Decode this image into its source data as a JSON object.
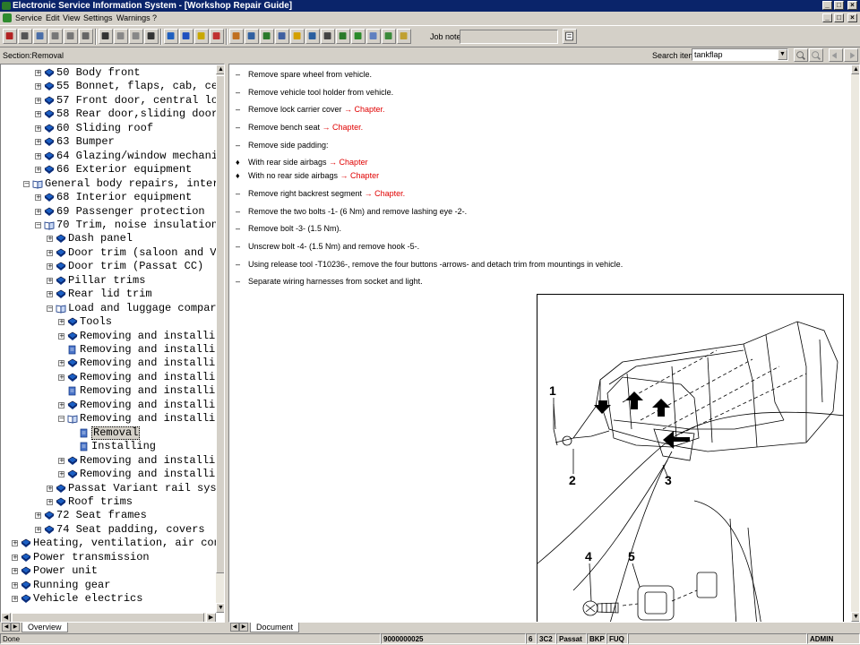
{
  "window": {
    "title": "Electronic Service Information System - [Workshop Repair Guide]",
    "controls": [
      "_",
      "□",
      "×"
    ],
    "mdi_controls": [
      "_",
      "□",
      "×"
    ]
  },
  "menu": [
    "Service",
    "Edit",
    "View",
    "Settings",
    "Warnings",
    "?"
  ],
  "toolbar": {
    "buttons": [
      "exit-icon",
      "print-icon",
      "print-preview-icon",
      "new-document-icon",
      "copy-icon",
      "vehicle-icon",
      "first-page-icon",
      "previous-page-icon",
      "next-page-icon",
      "last-page-icon",
      "back-icon",
      "info-icon",
      "help-icon",
      "swap-icon",
      "grid-icon",
      "person-icon",
      "documents-icon",
      "list-icon",
      "warning-icon",
      "globe-icon",
      "save-icon",
      "book-icon",
      "car-icon",
      "notes-icon",
      "check-icon",
      "edit-icon"
    ],
    "job_note_label": "Job note:",
    "job_note_value": ""
  },
  "section": {
    "label": "Section:Removal",
    "search_label": "Search item:",
    "search_value": "tankflap"
  },
  "tree": {
    "nodes": [
      {
        "label": "50 Body front",
        "level": 3,
        "expander": "+",
        "icon": "book-closed",
        "selected": false
      },
      {
        "label": "55 Bonnet, flaps, cab, ce",
        "level": 3,
        "expander": "+",
        "icon": "book-closed",
        "selected": false
      },
      {
        "label": "57 Front door, central lo",
        "level": 3,
        "expander": "+",
        "icon": "book-closed",
        "selected": false
      },
      {
        "label": "58 Rear door,sliding door",
        "level": 3,
        "expander": "+",
        "icon": "book-closed",
        "selected": false
      },
      {
        "label": "60 Sliding roof",
        "level": 3,
        "expander": "+",
        "icon": "book-closed",
        "selected": false
      },
      {
        "label": "63 Bumper",
        "level": 3,
        "expander": "+",
        "icon": "book-closed",
        "selected": false
      },
      {
        "label": "64 Glazing/window mechani",
        "level": 3,
        "expander": "+",
        "icon": "book-closed",
        "selected": false
      },
      {
        "label": "66 Exterior equipment",
        "level": 3,
        "expander": "+",
        "icon": "book-closed",
        "selected": false
      },
      {
        "label": "General body repairs, inter",
        "level": 2,
        "expander": "−",
        "icon": "book-open",
        "selected": false
      },
      {
        "label": "68 Interior equipment",
        "level": 3,
        "expander": "+",
        "icon": "book-closed",
        "selected": false
      },
      {
        "label": "69 Passenger protection",
        "level": 3,
        "expander": "+",
        "icon": "book-closed",
        "selected": false
      },
      {
        "label": "70 Trim, noise insulation",
        "level": 3,
        "expander": "−",
        "icon": "book-open",
        "selected": false
      },
      {
        "label": "Dash panel",
        "level": 4,
        "expander": "+",
        "icon": "book-closed",
        "selected": false
      },
      {
        "label": "Door trim (saloon and V",
        "level": 4,
        "expander": "+",
        "icon": "book-closed",
        "selected": false
      },
      {
        "label": "Door trim (Passat CC)",
        "level": 4,
        "expander": "+",
        "icon": "book-closed",
        "selected": false
      },
      {
        "label": "Pillar trims",
        "level": 4,
        "expander": "+",
        "icon": "book-closed",
        "selected": false
      },
      {
        "label": "Rear lid trim",
        "level": 4,
        "expander": "+",
        "icon": "book-closed",
        "selected": false
      },
      {
        "label": "Load and luggage compar",
        "level": 4,
        "expander": "−",
        "icon": "book-open",
        "selected": false
      },
      {
        "label": "Tools",
        "level": 5,
        "expander": "+",
        "icon": "book-closed",
        "selected": false
      },
      {
        "label": "Removing and installin",
        "level": 5,
        "expander": "+",
        "icon": "book-closed",
        "selected": false
      },
      {
        "label": "Removing and installin",
        "level": 5,
        "expander": "",
        "icon": "page",
        "selected": false
      },
      {
        "label": "Removing and installin",
        "level": 5,
        "expander": "+",
        "icon": "book-closed",
        "selected": false
      },
      {
        "label": "Removing and installin",
        "level": 5,
        "expander": "+",
        "icon": "book-closed",
        "selected": false
      },
      {
        "label": "Removing and installin",
        "level": 5,
        "expander": "",
        "icon": "page",
        "selected": false
      },
      {
        "label": "Removing and installin",
        "level": 5,
        "expander": "+",
        "icon": "book-closed",
        "selected": false
      },
      {
        "label": "Removing and installin",
        "level": 5,
        "expander": "−",
        "icon": "book-open",
        "selected": false
      },
      {
        "label": "Removal",
        "level": 6,
        "expander": "",
        "icon": "page",
        "selected": true
      },
      {
        "label": "Installing",
        "level": 6,
        "expander": "",
        "icon": "page",
        "selected": false
      },
      {
        "label": "Removing and installin",
        "level": 5,
        "expander": "+",
        "icon": "book-closed",
        "selected": false
      },
      {
        "label": "Removing and installin",
        "level": 5,
        "expander": "+",
        "icon": "book-closed",
        "selected": false
      },
      {
        "label": "Passat Variant rail sys",
        "level": 4,
        "expander": "+",
        "icon": "book-closed",
        "selected": false
      },
      {
        "label": "Roof trims",
        "level": 4,
        "expander": "+",
        "icon": "book-closed",
        "selected": false
      },
      {
        "label": "72 Seat frames",
        "level": 3,
        "expander": "+",
        "icon": "book-closed",
        "selected": false
      },
      {
        "label": "74 Seat padding, covers",
        "level": 3,
        "expander": "+",
        "icon": "book-closed",
        "selected": false
      },
      {
        "label": "Heating, ventilation, air con",
        "level": 1,
        "expander": "+",
        "icon": "book-closed",
        "selected": false
      },
      {
        "label": "Power transmission",
        "level": 1,
        "expander": "+",
        "icon": "book-closed",
        "selected": false
      },
      {
        "label": "Power unit",
        "level": 1,
        "expander": "+",
        "icon": "book-closed",
        "selected": false
      },
      {
        "label": "Running gear",
        "level": 1,
        "expander": "+",
        "icon": "book-closed",
        "selected": false
      },
      {
        "label": "Vehicle electrics",
        "level": 1,
        "expander": "+",
        "icon": "book-closed",
        "selected": false
      }
    ]
  },
  "tabs": {
    "left": "Overview",
    "right": "Document"
  },
  "document": {
    "steps": [
      {
        "bullet": "–",
        "text": "Remove spare wheel from vehicle.",
        "link": ""
      },
      {
        "bullet": "–",
        "text": "Remove vehicle tool holder from vehicle.",
        "link": ""
      },
      {
        "bullet": "–",
        "text": "Remove lock carrier cover",
        "link": "→ Chapter."
      },
      {
        "bullet": "–",
        "text": "Remove bench seat",
        "link": "→ Chapter."
      },
      {
        "bullet": "–",
        "text": "Remove side padding:",
        "link": ""
      },
      {
        "bullet": "♦",
        "text": "With rear side airbags",
        "link": "→ Chapter"
      },
      {
        "bullet": "♦",
        "text": "With no rear side airbags",
        "link": "→ Chapter"
      },
      {
        "bullet": "–",
        "text": "Remove right backrest segment",
        "link": "→ Chapter."
      },
      {
        "bullet": "–",
        "text": "Remove the two bolts -1- (6 Nm) and remove lashing eye -2-.",
        "link": ""
      },
      {
        "bullet": "–",
        "text": "Remove bolt -3- (1.5 Nm).",
        "link": ""
      },
      {
        "bullet": "–",
        "text": "Unscrew bolt -4- (1.5 Nm) and remove hook -5-.",
        "link": ""
      },
      {
        "bullet": "–",
        "text": "Using release tool -T10236-, remove the four buttons -arrows- and detach trim from mountings in vehicle.",
        "link": ""
      },
      {
        "bullet": "–",
        "text": "Separate wiring harnesses from socket and light.",
        "link": ""
      }
    ],
    "figure_callouts": [
      "1",
      "2",
      "3",
      "4",
      "5"
    ]
  },
  "status": {
    "left": "Done",
    "code": "9000000025",
    "field1": "6",
    "field2": "3C2",
    "model": "Passat",
    "field3": "BKP",
    "field4": "FUQ",
    "user": "ADMIN"
  },
  "colors": {
    "titlebar": "#0a246a",
    "link": "#e00000",
    "book_blue": "#1c5fc4"
  }
}
